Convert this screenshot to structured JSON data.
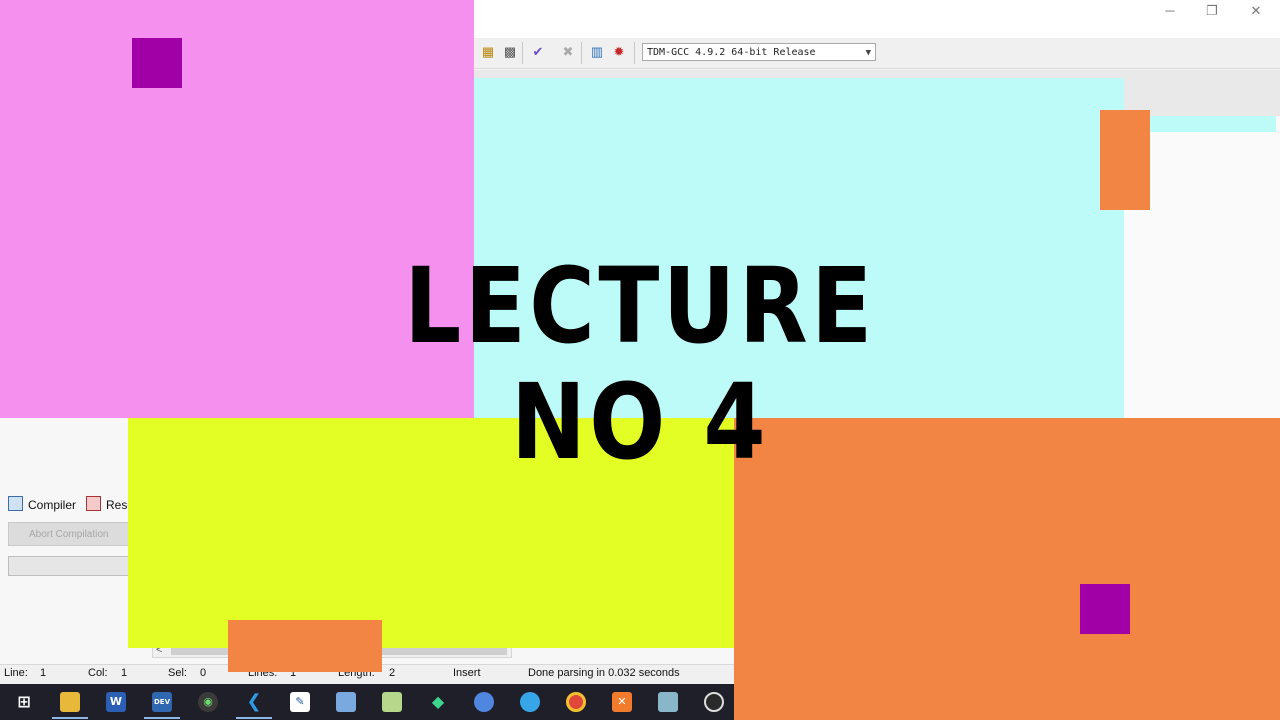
{
  "window": {
    "controls": {
      "minimize": "─",
      "restore": "❐",
      "close": "✕"
    }
  },
  "toolbar": {
    "compiler_select": "TDM-GCC 4.9.2 64-bit Release",
    "icons": [
      "project-grid-icon",
      "classes-grid-icon",
      "check-syntax-icon",
      "stop-icon",
      "chart-icon",
      "debug-icon"
    ]
  },
  "bottom_panel": {
    "tabs": [
      "Compiler",
      "Reso"
    ],
    "abort_button": "Abort Compilation"
  },
  "statusbar": {
    "line_label": "Line:",
    "line_value": "1",
    "col_label": "Col:",
    "col_value": "1",
    "sel_label": "Sel:",
    "sel_value": "0",
    "lines_label": "Lines:",
    "lines_value": "1",
    "length_label": "Length:",
    "length_value": "2",
    "mode": "Insert",
    "message": "Done parsing in 0.032 seconds"
  },
  "taskbar": {
    "apps": [
      "windows-start-icon",
      "file-explorer-icon",
      "word-icon",
      "dev-cpp-icon",
      "whatsapp-icon",
      "vscode-icon",
      "pen-app-icon",
      "3d-box-icon",
      "notepad-icon",
      "android-studio-icon",
      "browser-circle-icon",
      "edge-icon",
      "chrome-icon",
      "xampp-icon",
      "glass-app-icon",
      "obs-icon"
    ],
    "labels": {
      "word": "W",
      "devcpp": "DEV"
    }
  },
  "overlay": {
    "line1": "LECTURE",
    "line2": "NO 4"
  },
  "colors": {
    "pink": "#f590ef",
    "cyan": "#bdfbf8",
    "yellow": "#e3fe24",
    "orange": "#f28544",
    "purple": "#a000a6"
  }
}
